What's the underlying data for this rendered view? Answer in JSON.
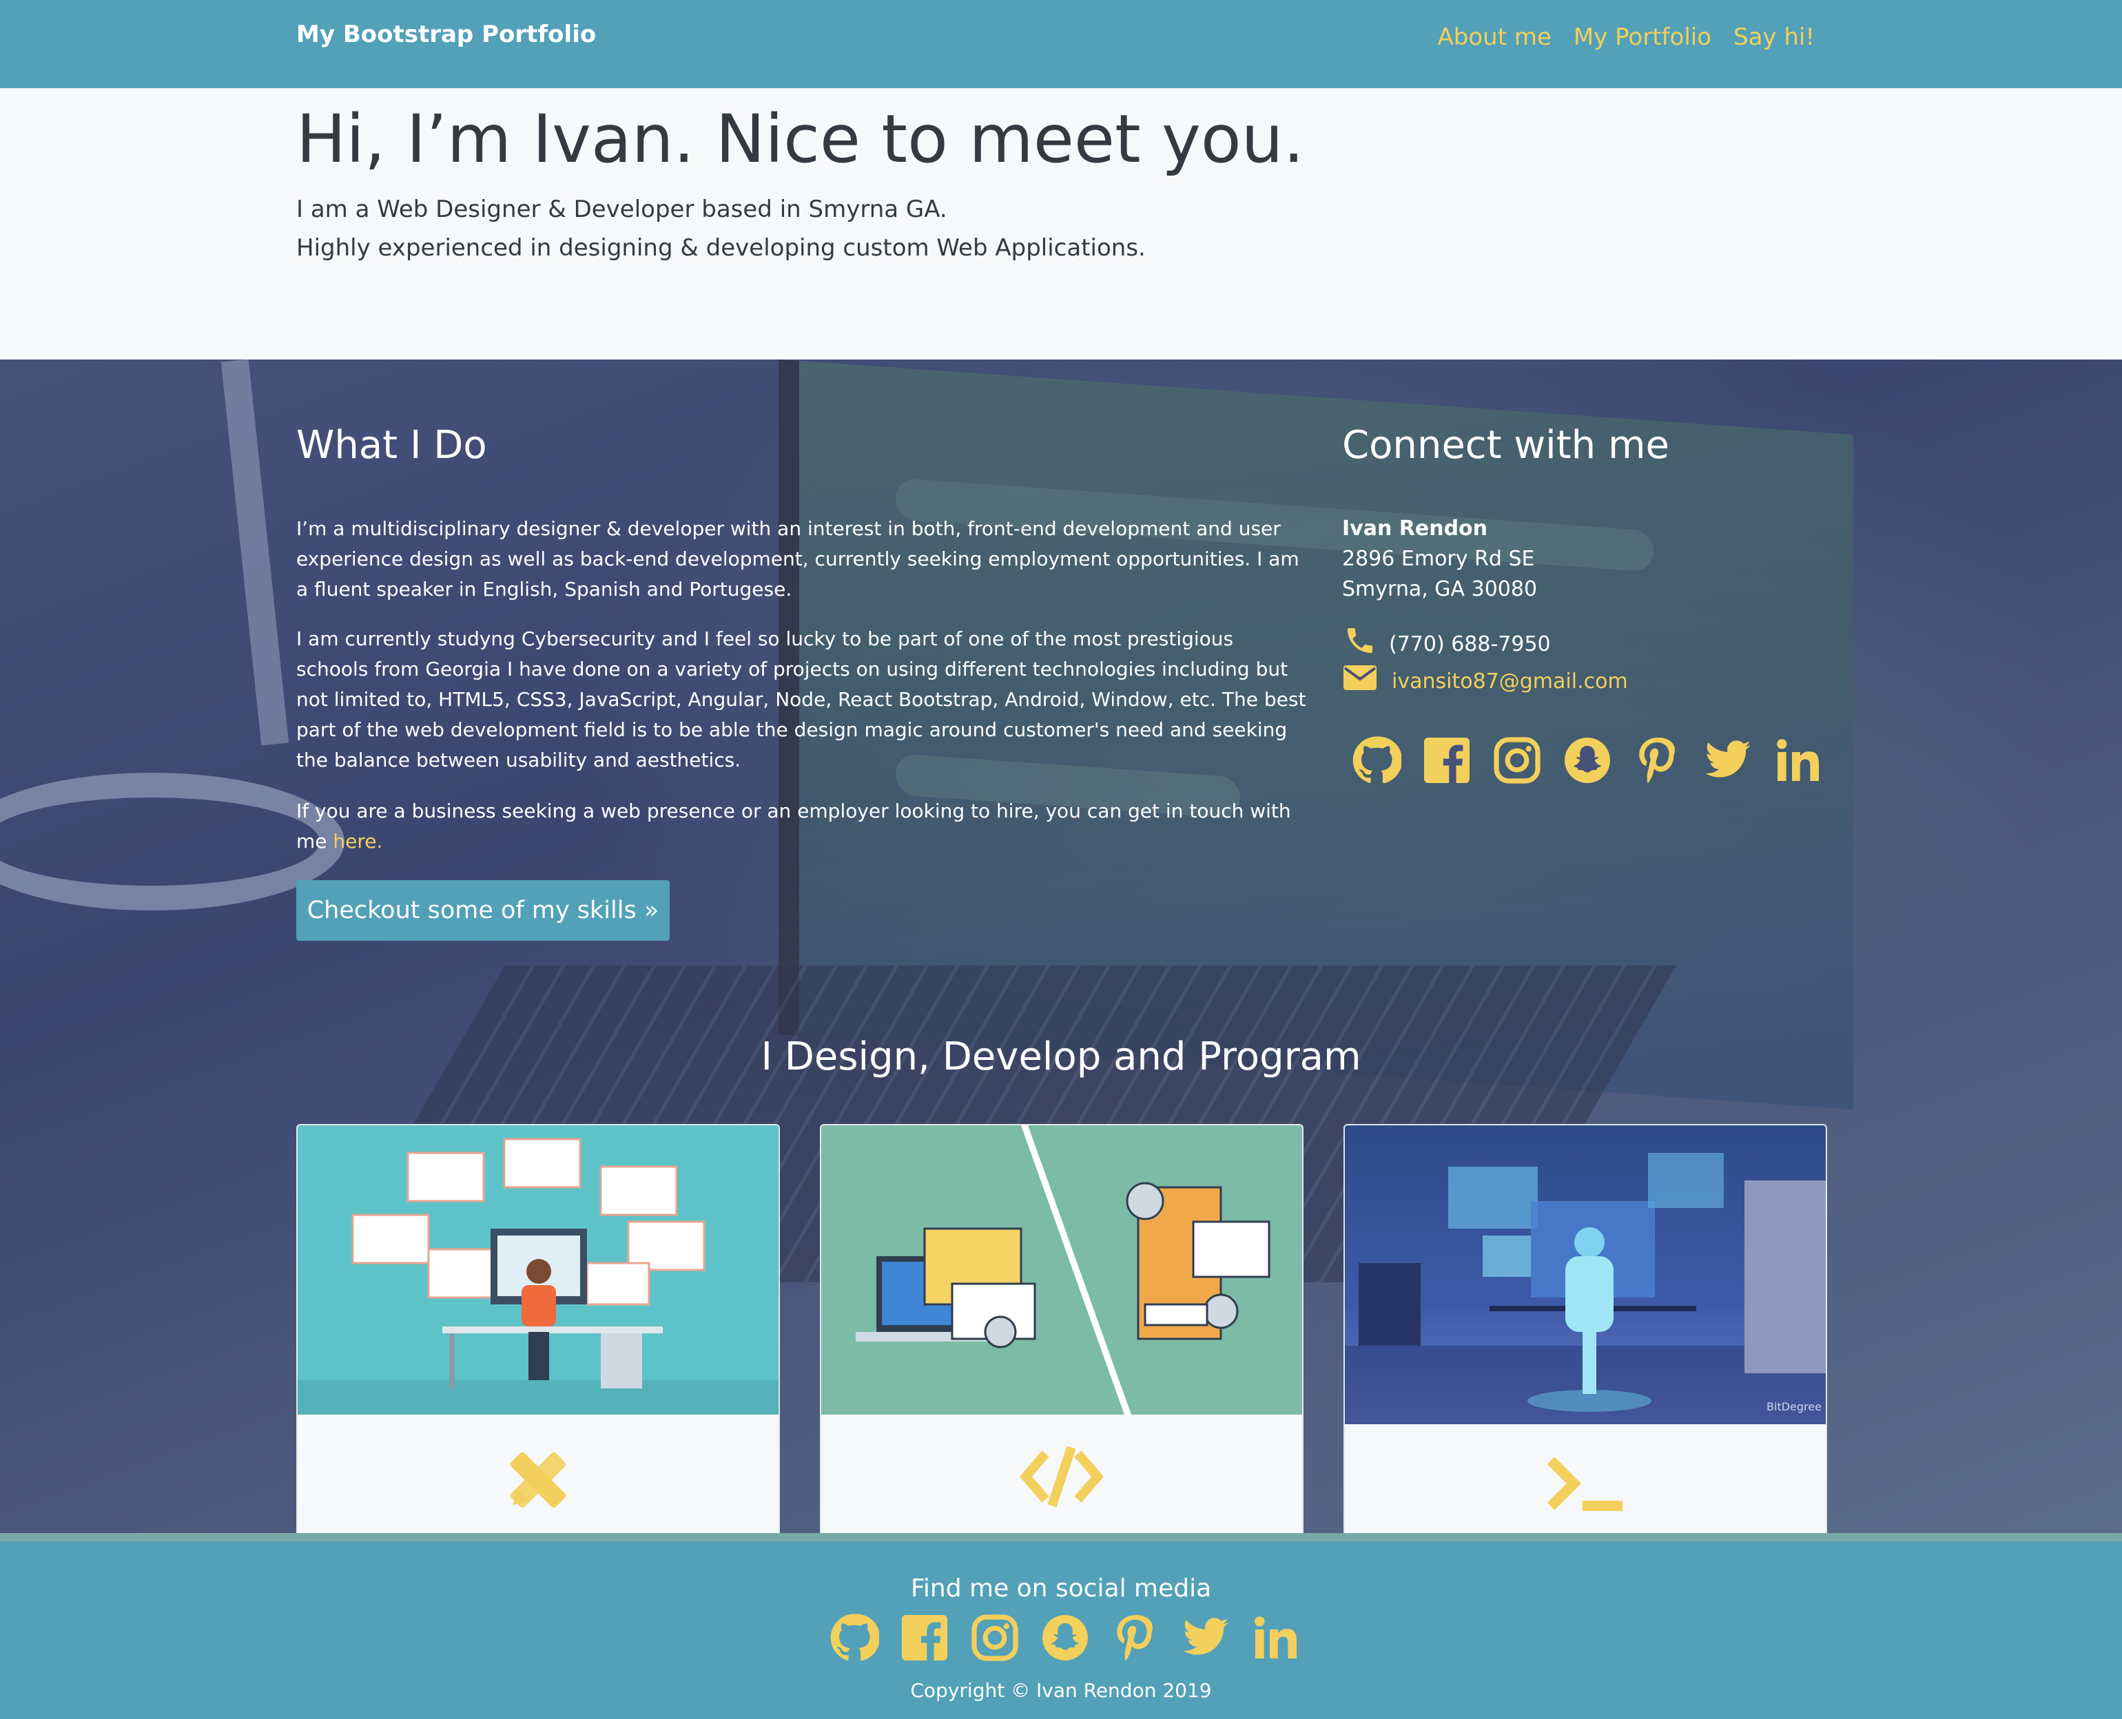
{
  "navbar": {
    "brand": "My Bootstrap Portfolio",
    "links": [
      "About me",
      "My Portfolio",
      "Say hi!"
    ]
  },
  "hero": {
    "title": "Hi, I’m Ivan. Nice to meet you.",
    "line1": "I am a Web Designer & Developer based in Smyrna GA.",
    "line2": "Highly experienced in designing & developing custom Web Applications."
  },
  "what_i_do": {
    "title": "What I Do",
    "p1": "I’m a multidisciplinary designer & developer with an interest in both, front-end development and user experience design as well as back-end development, currently seeking employment opportunities. I am a fluent speaker in English, Spanish and Portugese.",
    "p2": "I am currently studyng Cybersecurity and I feel so lucky to be part of one of the most prestigious schools from Georgia I have done on a variety of projects on using different technologies including but not limited to, HTML5, CSS3, JavaScript, Angular, Node, React Bootstrap, Android, Window, etc. The best part of the web development field is to be able the design magic around customer's need and seeking the balance between usability and aesthetics.",
    "p3": "If you are a business seeking a web presence or an employer looking to hire, you can get in touch with me ",
    "p3_link": "here.",
    "button": "Checkout some of my skills »"
  },
  "connect": {
    "title": "Connect with me",
    "name": "Ivan Rendon",
    "address1": "2896 Emory Rd SE",
    "address2": "Smyrna, GA 30080",
    "phone": "(770) 688-7950",
    "email": "ivansito87@gmail.com",
    "social_icons": [
      "github-icon",
      "facebook-icon",
      "instagram-icon",
      "snapchat-icon",
      "pinterest-icon",
      "twitter-icon",
      "linkedin-icon"
    ]
  },
  "design_section": {
    "title": "I Design, Develop and Program",
    "cards": [
      {
        "icon": "pencil-ruler-icon"
      },
      {
        "icon": "code-icon"
      },
      {
        "icon": "terminal-icon"
      }
    ],
    "card3_badge": "BitDegree"
  },
  "footer": {
    "title": "Find me on social media",
    "copyright": "Copyright © Ivan Rendon 2019"
  },
  "colors": {
    "navbar": "#52a1b8",
    "accent": "#f3cf5c",
    "hero_bg": "#f7f8fa",
    "text_dark": "#343a40"
  }
}
